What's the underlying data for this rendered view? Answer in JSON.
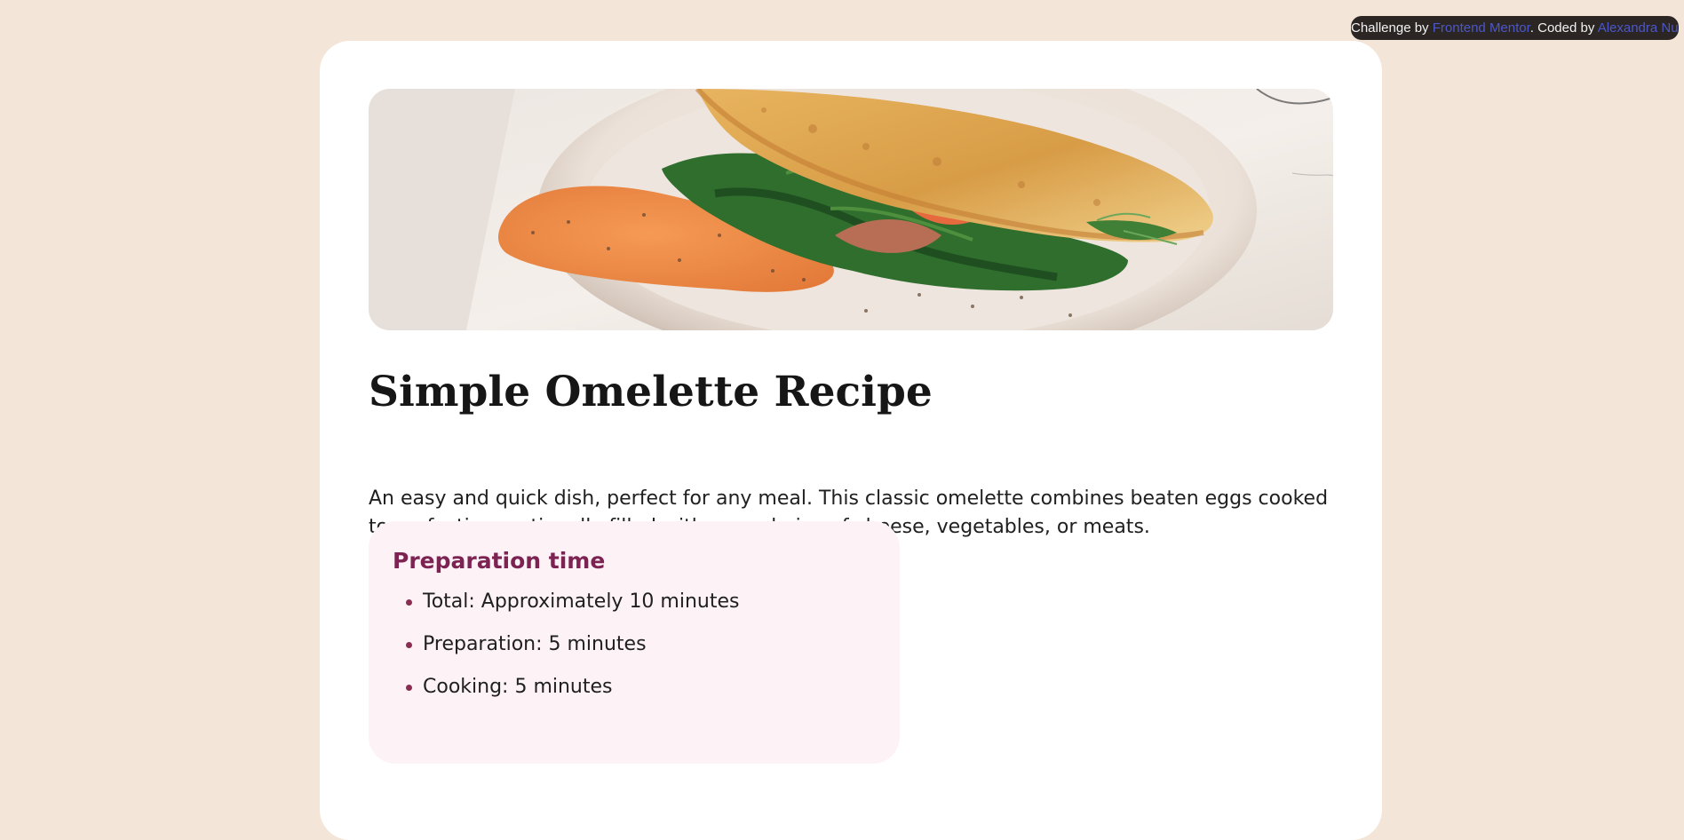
{
  "attribution": {
    "prefix": "Challenge by ",
    "challenge_link": "Frontend Mentor",
    "middle": ". Coded by ",
    "author_link": "Alexandra Nuthe",
    "suffix": "."
  },
  "recipe": {
    "title": "Simple Omelette Recipe",
    "intro": "An easy and quick dish, perfect for any meal. This classic omelette combines beaten eggs cooked to perfection, optionally filled with your choice of cheese, vegetables, or meats."
  },
  "preparation": {
    "title": "Preparation time",
    "items": [
      "Total: Approximately 10 minutes",
      "Preparation: 5 minutes",
      "Cooking: 5 minutes"
    ]
  },
  "colors": {
    "page_background": "#f3e5d8",
    "card_background": "#ffffff",
    "prep_background": "#fdf3f7",
    "prep_title": "#7c2352",
    "attribution_background": "#2b2624",
    "attribution_link": "#4b57c9"
  }
}
